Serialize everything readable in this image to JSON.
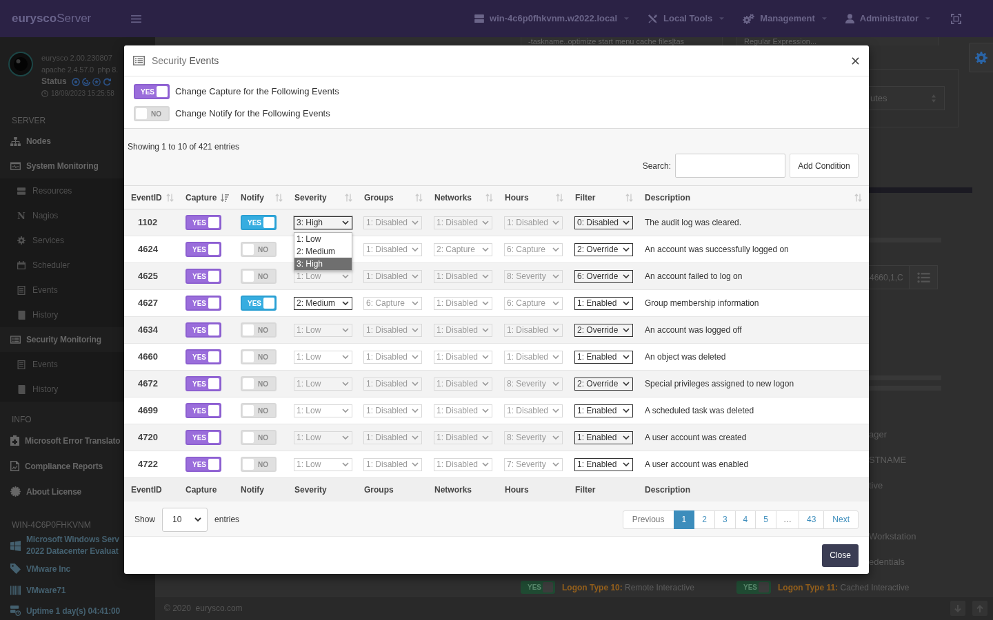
{
  "topbar": {
    "logo": "**eurysco**Server",
    "menu": [
      {
        "label": "win-4c6p0fhkvnm.w2022.local"
      },
      {
        "label": "Local Tools"
      },
      {
        "label": "Management"
      },
      {
        "label": "Administrator"
      }
    ]
  },
  "sidebar": {
    "version": "eurysco 2.00.230807",
    "server": "apache 2.4.57.0  php 8.",
    "status_label": "Status",
    "timestamp": "18/09/2023 15:25:58",
    "sections": [
      {
        "title": "SERVER",
        "items": [
          {
            "label": "Nodes"
          },
          {
            "label": "System Monitoring",
            "children": [
              {
                "label": "Resources"
              },
              {
                "label": "Nagios",
                "glyph": "N"
              },
              {
                "label": "Services"
              },
              {
                "label": "Scheduler"
              },
              {
                "label": "Events"
              },
              {
                "label": "History"
              }
            ]
          },
          {
            "label": "Security Monitoring",
            "children": [
              {
                "label": "Events"
              },
              {
                "label": "History"
              }
            ]
          }
        ]
      },
      {
        "title": "INFO",
        "items": [
          {
            "label": "Microsoft Error Translato"
          },
          {
            "label": "Compliance Reports"
          },
          {
            "label": "About License"
          }
        ]
      },
      {
        "title": "WIN-4C6P0FHKVNM",
        "items": [
          {
            "lines": [
              "Microsoft Windows Serv",
              "2022 Datacenter Evaluat"
            ]
          },
          {
            "label": "VMware Inc"
          },
          {
            "label": "VMware71"
          },
          {
            "label": "Uptime 1 day(s) 04:41:00"
          }
        ]
      }
    ]
  },
  "main": {
    "filters": [
      {
        "value": "-taskname..optimize start menu cache files|tas"
      },
      {
        "placeholder": "Regular Expression..."
      }
    ],
    "interval_select": {
      "value": "utes"
    },
    "lookup_field": {
      "value": "4660,1,C"
    },
    "labels": [
      "ager",
      "STNAME",
      "tive",
      "Workstation",
      "edentials"
    ],
    "logon_types": [
      {
        "switch": {
          "on": true,
          "text": "YES"
        },
        "label": "**Logon Type 10:** Remote Interactive"
      },
      {
        "switch": {
          "on": true,
          "text": "YES"
        },
        "label": "**Logon Type 11:** Cached Interactive"
      }
    ]
  },
  "footer": {
    "copyright": "© 2020  eurysco.com"
  },
  "modal": {
    "title": "Security **Events**",
    "switches": [
      {
        "on": true,
        "text": "YES",
        "label": "Change Capture for the Following Events"
      },
      {
        "on": false,
        "text": "NO",
        "label": "Change Notify for the Following Events"
      }
    ],
    "summary": "Showing 1 to 10 of 421 entries",
    "search": {
      "label": "Search:"
    },
    "add_button": "Add Condition",
    "table": {
      "columns": [
        {
          "label": "EventID",
          "sorted": false
        },
        {
          "label": "Capture",
          "sorted": true
        },
        {
          "label": "Notify",
          "sorted": false
        },
        {
          "label": "Severity",
          "sorted": false
        },
        {
          "label": "Groups",
          "sorted": false
        },
        {
          "label": "Networks",
          "sorted": false
        },
        {
          "label": "Hours",
          "sorted": false
        },
        {
          "label": "Filter",
          "sorted": false
        },
        {
          "label": "Description",
          "sorted": false
        }
      ],
      "rows": [
        {
          "event_id": "1102",
          "capture": {
            "on": true,
            "text": "YES"
          },
          "notify": {
            "on": true,
            "text": "YES"
          },
          "severity": {
            "value": "3: High",
            "disabled": false,
            "expanded": true,
            "options": [
              {
                "label": "1: Low",
                "selected": false
              },
              {
                "label": "2: Medium",
                "selected": false
              },
              {
                "label": "3: High",
                "selected": true
              }
            ]
          },
          "groups": {
            "value": "1: Disabled",
            "disabled": true
          },
          "networks": {
            "value": "1: Disabled",
            "disabled": true
          },
          "hours": {
            "value": "1: Disabled",
            "disabled": true
          },
          "filter": {
            "value": "0: Disabled",
            "disabled": false
          },
          "description": "The audit log was cleared."
        },
        {
          "event_id": "4624",
          "capture": {
            "on": true,
            "text": "YES"
          },
          "notify": {
            "on": false,
            "text": "NO"
          },
          "groups": {
            "value": "1: Disabled",
            "disabled": true
          },
          "networks": {
            "value": "2: Capture",
            "disabled": true
          },
          "hours": {
            "value": "6: Capture",
            "disabled": true
          },
          "filter": {
            "value": "2: Override",
            "disabled": false
          },
          "description": "An account was successfully logged on"
        },
        {
          "event_id": "4625",
          "capture": {
            "on": true,
            "text": "YES"
          },
          "notify": {
            "on": false,
            "text": "NO"
          },
          "severity": {
            "value": "1: Low",
            "disabled": true,
            "expanded": false
          },
          "groups": {
            "value": "1: Disabled",
            "disabled": true
          },
          "networks": {
            "value": "1: Disabled",
            "disabled": true
          },
          "hours": {
            "value": "8: Severity",
            "disabled": true
          },
          "filter": {
            "value": "6: Override",
            "disabled": false
          },
          "description": "An account failed to log on"
        },
        {
          "event_id": "4627",
          "capture": {
            "on": true,
            "text": "YES"
          },
          "notify": {
            "on": true,
            "text": "YES"
          },
          "severity": {
            "value": "2: Medium",
            "disabled": false,
            "expanded": false
          },
          "groups": {
            "value": "6: Capture",
            "disabled": true
          },
          "networks": {
            "value": "1: Disabled",
            "disabled": true
          },
          "hours": {
            "value": "6: Capture",
            "disabled": true
          },
          "filter": {
            "value": "1: Enabled",
            "disabled": false
          },
          "description": "Group membership information"
        },
        {
          "event_id": "4634",
          "capture": {
            "on": true,
            "text": "YES"
          },
          "notify": {
            "on": false,
            "text": "NO"
          },
          "severity": {
            "value": "1: Low",
            "disabled": true,
            "expanded": false
          },
          "groups": {
            "value": "1: Disabled",
            "disabled": true
          },
          "networks": {
            "value": "1: Disabled",
            "disabled": true
          },
          "hours": {
            "value": "1: Disabled",
            "disabled": true
          },
          "filter": {
            "value": "2: Override",
            "disabled": false
          },
          "description": "An account was logged off"
        },
        {
          "event_id": "4660",
          "capture": {
            "on": true,
            "text": "YES"
          },
          "notify": {
            "on": false,
            "text": "NO"
          },
          "severity": {
            "value": "1: Low",
            "disabled": true,
            "expanded": false
          },
          "groups": {
            "value": "1: Disabled",
            "disabled": true
          },
          "networks": {
            "value": "1: Disabled",
            "disabled": true
          },
          "hours": {
            "value": "1: Disabled",
            "disabled": true
          },
          "filter": {
            "value": "1: Enabled",
            "disabled": false
          },
          "description": "An object was deleted"
        },
        {
          "event_id": "4672",
          "capture": {
            "on": true,
            "text": "YES"
          },
          "notify": {
            "on": false,
            "text": "NO"
          },
          "severity": {
            "value": "1: Low",
            "disabled": true,
            "expanded": false
          },
          "groups": {
            "value": "1: Disabled",
            "disabled": true
          },
          "networks": {
            "value": "1: Disabled",
            "disabled": true
          },
          "hours": {
            "value": "8: Severity",
            "disabled": true
          },
          "filter": {
            "value": "2: Override",
            "disabled": false
          },
          "description": "Special privileges assigned to new logon"
        },
        {
          "event_id": "4699",
          "capture": {
            "on": true,
            "text": "YES"
          },
          "notify": {
            "on": false,
            "text": "NO"
          },
          "severity": {
            "value": "1: Low",
            "disabled": true,
            "expanded": false
          },
          "groups": {
            "value": "1: Disabled",
            "disabled": true
          },
          "networks": {
            "value": "1: Disabled",
            "disabled": true
          },
          "hours": {
            "value": "1: Disabled",
            "disabled": true
          },
          "filter": {
            "value": "1: Enabled",
            "disabled": false
          },
          "description": "A scheduled task was deleted"
        },
        {
          "event_id": "4720",
          "capture": {
            "on": true,
            "text": "YES"
          },
          "notify": {
            "on": false,
            "text": "NO"
          },
          "severity": {
            "value": "1: Low",
            "disabled": true,
            "expanded": false
          },
          "groups": {
            "value": "1: Disabled",
            "disabled": true
          },
          "networks": {
            "value": "1: Disabled",
            "disabled": true
          },
          "hours": {
            "value": "8: Severity",
            "disabled": true
          },
          "filter": {
            "value": "1: Enabled",
            "disabled": false
          },
          "description": "A user account was created"
        },
        {
          "event_id": "4722",
          "capture": {
            "on": true,
            "text": "YES"
          },
          "notify": {
            "on": false,
            "text": "NO"
          },
          "severity": {
            "value": "1: Low",
            "disabled": true,
            "expanded": false
          },
          "groups": {
            "value": "1: Disabled",
            "disabled": true
          },
          "networks": {
            "value": "1: Disabled",
            "disabled": true
          },
          "hours": {
            "value": "7: Severity",
            "disabled": true
          },
          "filter": {
            "value": "1: Enabled",
            "disabled": false
          },
          "description": "A user account was enabled"
        }
      ],
      "footer": [
        "EventID",
        "Capture",
        "Notify",
        "Severity",
        "Groups",
        "Networks",
        "Hours",
        "Filter",
        "Description"
      ]
    },
    "page_length": {
      "label": "Show",
      "value": "10",
      "suffix": "entries"
    },
    "pagination": [
      {
        "kind": "previous",
        "label": "Previous",
        "selected": false,
        "disabled": true
      },
      {
        "kind": "page",
        "label": "1",
        "selected": true,
        "disabled": false
      },
      {
        "kind": "page",
        "label": "2",
        "selected": false,
        "disabled": false
      },
      {
        "kind": "page",
        "label": "3",
        "selected": false,
        "disabled": false
      },
      {
        "kind": "page",
        "label": "4",
        "selected": false,
        "disabled": false
      },
      {
        "kind": "page",
        "label": "5",
        "selected": false,
        "disabled": false
      },
      {
        "kind": "ellipsis",
        "label": "…",
        "selected": false,
        "disabled": true
      },
      {
        "kind": "page",
        "label": "43",
        "selected": false,
        "disabled": false
      },
      {
        "kind": "next",
        "label": "Next",
        "selected": false,
        "disabled": false
      }
    ],
    "close_button": "Close"
  }
}
